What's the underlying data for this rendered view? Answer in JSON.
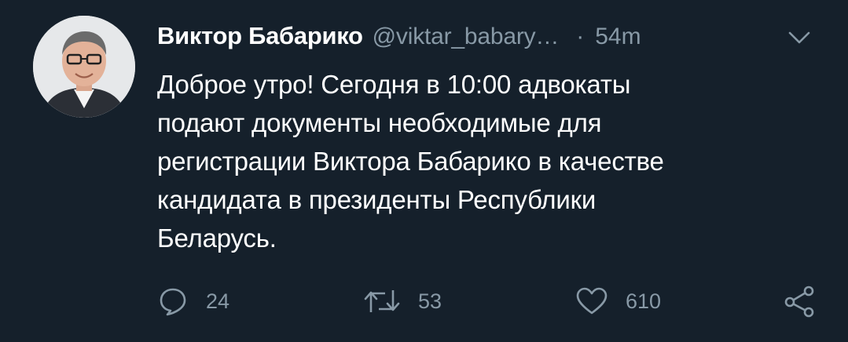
{
  "tweet": {
    "author": {
      "display_name": "Виктор Бабарико",
      "handle": "@viktar_babary…",
      "separator": "·",
      "timestamp": "54m"
    },
    "text": "Доброе утро! Сегодня в 10:00 адвокаты\nподают документы необходимые для\nрегистрации Виктора Бабарико в качестве\nкандидата в президенты Республики\nБеларусь.",
    "actions": {
      "reply": {
        "icon": "reply-icon",
        "count": "24"
      },
      "retweet": {
        "icon": "retweet-icon",
        "count": "53"
      },
      "like": {
        "icon": "heart-icon",
        "count": "610"
      },
      "share": {
        "icon": "share-icon"
      }
    }
  },
  "colors": {
    "background": "#15202b",
    "text_primary": "#ffffff",
    "text_secondary": "#8899a6"
  }
}
